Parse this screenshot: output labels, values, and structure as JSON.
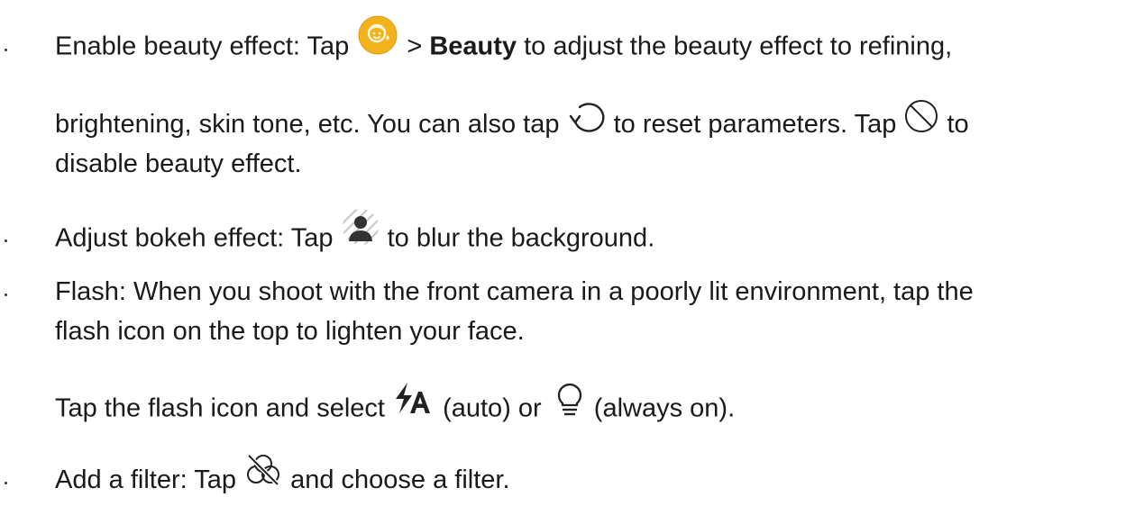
{
  "items": [
    {
      "lines": [
        {
          "a": "Enable beauty effect: Tap ",
          "b_pre": " > ",
          "b": "Beauty",
          "c": " to adjust the beauty effect to refining,"
        },
        {
          "a": "brightening, skin tone, etc. You can also tap ",
          "b": " to reset parameters. Tap ",
          "c": " to"
        },
        {
          "a": "disable beauty effect."
        }
      ]
    },
    {
      "lines": [
        {
          "a": "Adjust bokeh effect: Tap ",
          "b": " to blur the background."
        }
      ]
    },
    {
      "lines": [
        {
          "a": "Flash: When you shoot with the front camera in a poorly lit environment, tap the"
        },
        {
          "a": "flash icon on the top to lighten your face."
        },
        {
          "a": "Tap the flash icon and select ",
          "b": " (auto) or ",
          "c": " (always on)."
        }
      ]
    },
    {
      "lines": [
        {
          "a": "Add a filter: Tap ",
          "b": " and choose a filter."
        }
      ]
    }
  ],
  "colors": {
    "text": "#1a1a1a",
    "beauty_icon": "#f2b21b",
    "icon_stroke": "#222222",
    "bokeh_gray": "#bdbdbd"
  },
  "icons": [
    "beauty-icon",
    "reset-icon",
    "disable-icon",
    "bokeh-icon",
    "flash-auto-icon",
    "flash-on-icon",
    "filter-off-icon"
  ]
}
